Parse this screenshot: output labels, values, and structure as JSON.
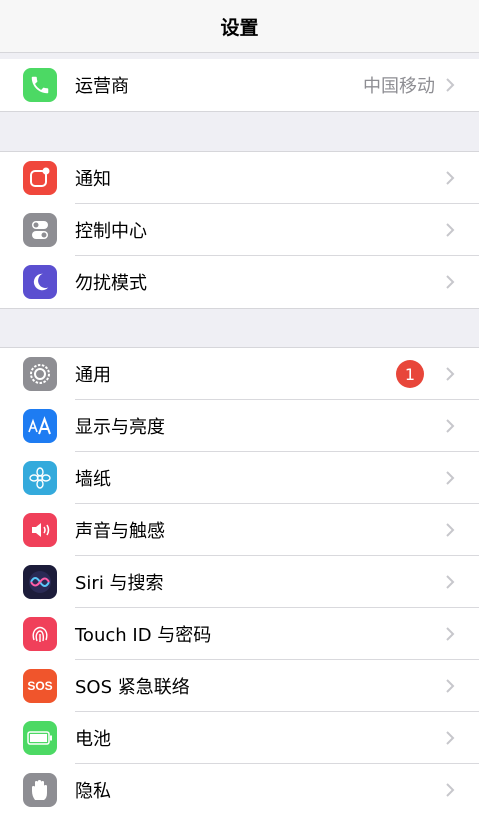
{
  "header": {
    "title": "设置"
  },
  "group_carrier": [
    {
      "label": "运营商",
      "detail": "中国移动",
      "icon": "phone-icon",
      "color": "#4cd964"
    }
  ],
  "group_notifications": [
    {
      "label": "通知",
      "icon": "notifications-icon",
      "color": "#f0473c"
    },
    {
      "label": "控制中心",
      "icon": "control-center-icon",
      "color": "#8e8e93"
    },
    {
      "label": "勿扰模式",
      "icon": "moon-icon",
      "color": "#5b4fd0"
    }
  ],
  "group_general": [
    {
      "label": "通用",
      "badge": "1",
      "icon": "gear-icon",
      "color": "#8e8e93"
    },
    {
      "label": "显示与亮度",
      "icon": "text-size-icon",
      "color": "#1e7cf2"
    },
    {
      "label": "墙纸",
      "icon": "flower-icon",
      "color": "#34aadc"
    },
    {
      "label": "声音与触感",
      "icon": "speaker-icon",
      "color": "#f0405a"
    },
    {
      "label": "Siri 与搜索",
      "icon": "siri-icon",
      "color": "#1c1c3a"
    },
    {
      "label": "Touch ID 与密码",
      "icon": "fingerprint-icon",
      "color": "#f0405a"
    },
    {
      "label": "SOS 紧急联络",
      "icon": "sos-icon",
      "icon_text": "SOS",
      "color": "#f0552c"
    },
    {
      "label": "电池",
      "icon": "battery-icon",
      "color": "#4cd964"
    },
    {
      "label": "隐私",
      "icon": "hand-icon",
      "color": "#8e8e93"
    }
  ]
}
